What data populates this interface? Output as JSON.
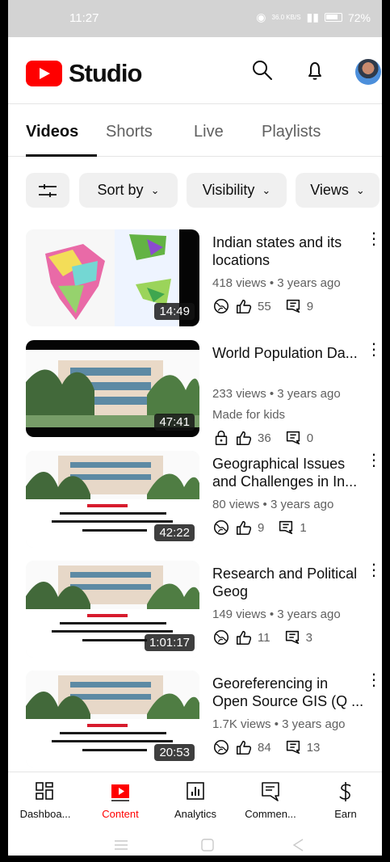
{
  "status_bar": {
    "time": "11:27",
    "net_speed": "36.0\nKB/S",
    "battery": "72%"
  },
  "header": {
    "app_name": "Studio",
    "search_icon": "search-icon",
    "notification_icon": "bell-icon"
  },
  "tabs": [
    "Videos",
    "Shorts",
    "Live",
    "Playlists"
  ],
  "filters": {
    "sort_by": "Sort by",
    "visibility": "Visibility",
    "views": "Views"
  },
  "videos": [
    {
      "title": "Indian states and its locations",
      "meta": "418 views • 3 years ago",
      "likes": "55",
      "comments": "9",
      "duration": "14:49",
      "visibility": "globe-icon"
    },
    {
      "title": "World Population Da...",
      "meta": "233 views • 3 years ago",
      "kids": "Made for kids",
      "likes": "36",
      "comments": "0",
      "duration": "47:41",
      "visibility": "lock-icon"
    },
    {
      "title": "Geographical Issues and Challenges in In...",
      "meta": "80 views • 3 years ago",
      "likes": "9",
      "comments": "1",
      "duration": "42:22",
      "visibility": "globe-icon"
    },
    {
      "title": "Research and Political Geog",
      "meta": "149 views • 3 years ago",
      "likes": "11",
      "comments": "3",
      "duration": "1:01:17",
      "visibility": "globe-icon"
    },
    {
      "title": "Georeferencing in Open Source GIS (Q ...",
      "meta": "1.7K views • 3 years ago",
      "likes": "84",
      "comments": "13",
      "duration": "20:53",
      "visibility": "globe-icon"
    }
  ],
  "bottom_nav": [
    "Dashboa...",
    "Content",
    "Analytics",
    "Commen...",
    "Earn"
  ],
  "colors": {
    "accent": "#ff0000",
    "text": "#0f0f0f",
    "secondary": "#606060",
    "chip": "#f0f0f0"
  }
}
